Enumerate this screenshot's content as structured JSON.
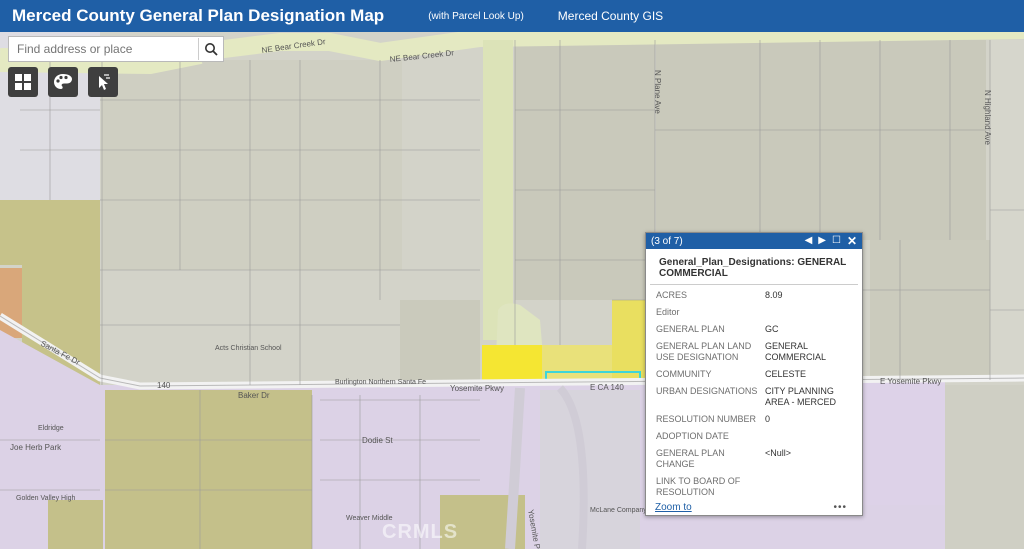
{
  "header": {
    "title": "Merced County General Plan Designation Map",
    "subtitle": "(with Parcel Look Up)",
    "link": "Merced County GIS"
  },
  "search": {
    "placeholder": "Find address or place"
  },
  "tools": [
    "basemap-gallery-icon",
    "legend-palette-icon",
    "identify-pointer-icon"
  ],
  "map": {
    "streets": {
      "bear_creek_1": "NE Bear Creek Dr",
      "bear_creek_2": "NE Bear Creek Dr",
      "yosemite_w": "Yosemite Pkwy",
      "yosemite_e": "E Yosemite Pkwy",
      "ca140": "E CA 140",
      "rt140": "140",
      "baker": "Baker Dr",
      "dodie": "Dodie St",
      "parkway": "Yosemite Pkwy",
      "plane_ave": "N Plane Ave",
      "ne_ave": "N Highland Ave",
      "santa_fe": "Santa Fe Dr",
      "burlington": "Burlington Northern Santa Fe",
      "r4": "Joe Herb Park",
      "school1": "Acts Christian School",
      "school2": "Golden Valley High",
      "school3": "Weaver Middle",
      "school4": "McLane Company",
      "easy_st": "Eldridge"
    },
    "watermark": "CRMLS"
  },
  "popup": {
    "count": "(3 of 7)",
    "title": "General_Plan_Designations: GENERAL COMMERCIAL",
    "fields": [
      {
        "key": "ACRES",
        "value": "8.09"
      },
      {
        "key": "Editor",
        "value": ""
      },
      {
        "key": "GENERAL PLAN",
        "value": "GC"
      },
      {
        "key": "GENERAL PLAN LAND USE DESIGNATION",
        "value": "GENERAL COMMERCIAL"
      },
      {
        "key": "COMMUNITY",
        "value": "CELESTE"
      },
      {
        "key": "URBAN DESIGNATIONS",
        "value": "CITY PLANNING AREA - MERCED"
      },
      {
        "key": "RESOLUTION NUMBER",
        "value": "0"
      },
      {
        "key": "ADOPTION DATE",
        "value": ""
      },
      {
        "key": "GENERAL PLAN CHANGE",
        "value": "<Null>"
      },
      {
        "key": "LINK TO BOARD OF RESOLUTION",
        "value": ""
      }
    ],
    "zoom_label": "Zoom to",
    "more_label": "•••"
  },
  "colors": {
    "header": "#1f5fa6",
    "agriculture": "#d3d3c9",
    "residential_olive": "#c6c28a",
    "commercial_yellow": "#f5e632",
    "purple_zone": "#dcd2e6",
    "road_green": "#e4e9c2"
  }
}
